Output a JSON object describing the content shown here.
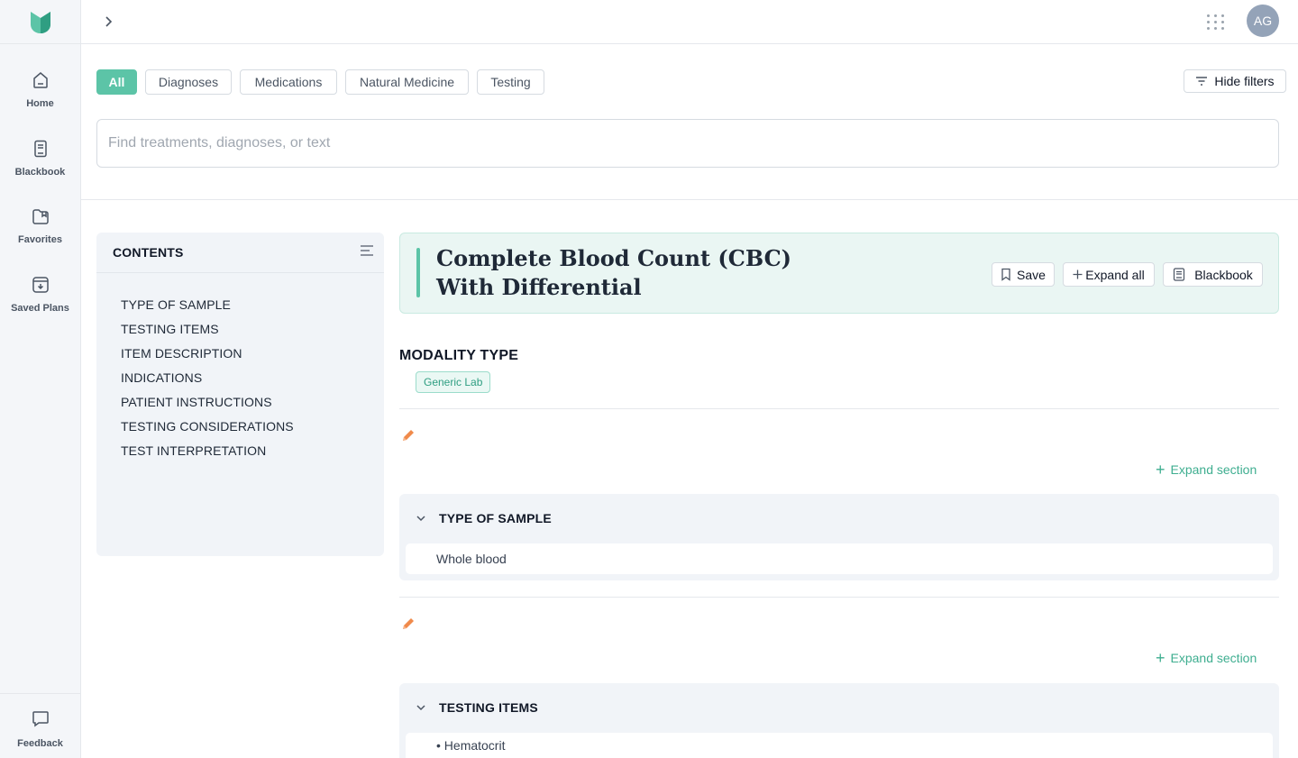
{
  "rail": {
    "items": [
      {
        "label": "Home",
        "icon": "home-icon"
      },
      {
        "label": "Blackbook",
        "icon": "book-icon"
      },
      {
        "label": "Favorites",
        "icon": "folder-icon"
      },
      {
        "label": "Saved Plans",
        "icon": "save-box-icon"
      }
    ],
    "feedback": {
      "label": "Feedback",
      "icon": "chat-bubble-icon"
    }
  },
  "header": {
    "avatar_initials": "AG"
  },
  "filters": {
    "chips": [
      "All",
      "Diagnoses",
      "Medications",
      "Natural Medicine",
      "Testing"
    ],
    "active": "All",
    "hide_label": "Hide filters"
  },
  "search": {
    "placeholder": "Find treatments, diagnoses, or text",
    "value": ""
  },
  "contents": {
    "title": "CONTENTS",
    "items": [
      "TYPE OF SAMPLE",
      "TESTING ITEMS",
      "ITEM DESCRIPTION",
      "INDICATIONS",
      "PATIENT INSTRUCTIONS",
      "TESTING CONSIDERATIONS",
      "TEST INTERPRETATION"
    ]
  },
  "article": {
    "title": "Complete Blood Count (CBC) With Differential",
    "actions": {
      "save": "Save",
      "expand_all": "Expand all",
      "blackbook": "Blackbook"
    },
    "modality_label": "MODALITY TYPE",
    "modality_tag": "Generic Lab",
    "expand_section_label": "Expand section",
    "sections": [
      {
        "title": "TYPE OF SAMPLE",
        "body": "Whole blood"
      },
      {
        "title": "TESTING ITEMS",
        "body": "• Hematocrit"
      }
    ]
  },
  "colors": {
    "accent": "#5cc4a7",
    "accent_text": "#3fae90",
    "pencil": "#f08a4b",
    "rail_bg": "#f4f6f9"
  }
}
